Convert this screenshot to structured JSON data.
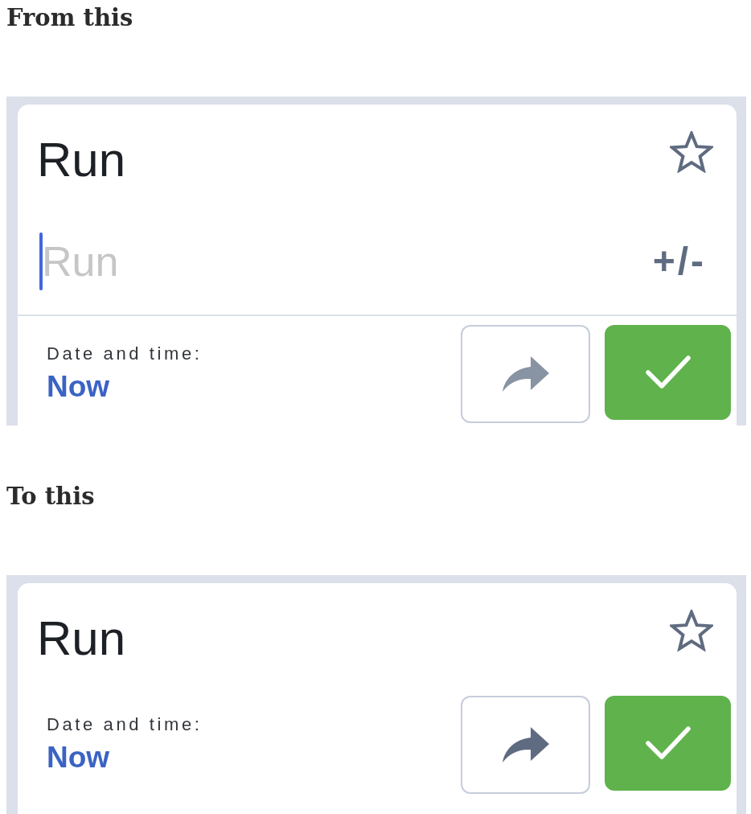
{
  "sections": [
    {
      "heading": "From this",
      "screen": {
        "title": "Run",
        "starred": false,
        "amount_field": {
          "placeholder": "Run",
          "focused": true,
          "sign_toggle": "+/-"
        },
        "date_label": "Date and time:",
        "date_value": "Now",
        "share_button": {
          "disabled": true
        }
      }
    },
    {
      "heading": "To this",
      "screen": {
        "title": "Run",
        "starred": false,
        "date_label": "Date and time:",
        "date_value": "Now",
        "share_button": {
          "disabled": false
        }
      }
    }
  ]
}
